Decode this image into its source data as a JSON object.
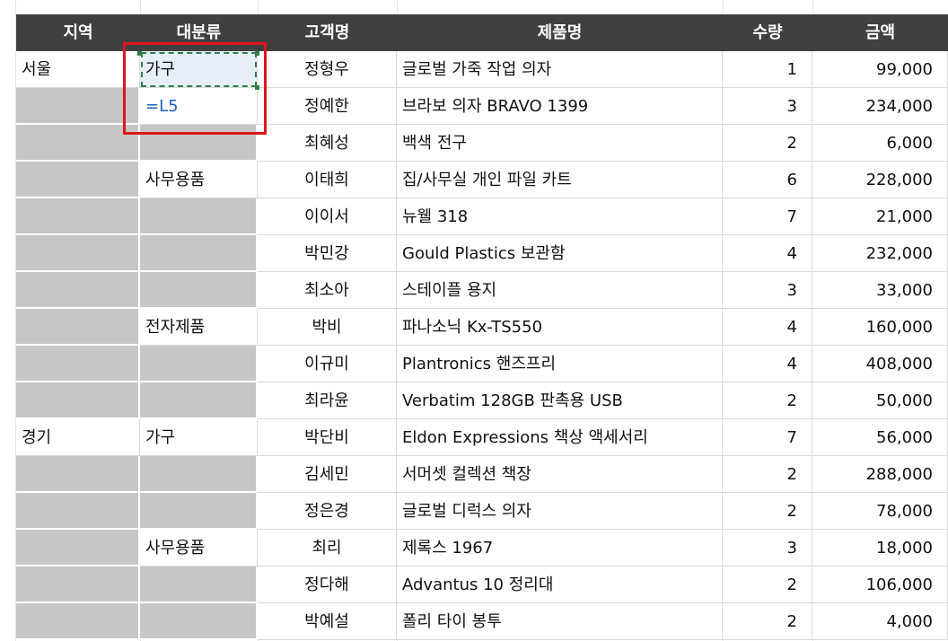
{
  "headers": [
    "지역",
    "대분류",
    "고객명",
    "제품명",
    "수량",
    "금액"
  ],
  "rows": [
    {
      "region": "서울",
      "category": "가구",
      "customer": "정형우",
      "product": "글로벌 가죽 작업 의자",
      "qty": "1",
      "amount": "99,000"
    },
    {
      "region": "",
      "category": "=L5",
      "customer": "정예한",
      "product": "브라보 의자 BRAVO 1399",
      "qty": "3",
      "amount": "234,000"
    },
    {
      "region": "",
      "category": "",
      "customer": "최혜성",
      "product": "백색 전구",
      "qty": "2",
      "amount": "6,000"
    },
    {
      "region": "",
      "category": "사무용품",
      "customer": "이태희",
      "product": "집/사무실 개인 파일 카트",
      "qty": "6",
      "amount": "228,000"
    },
    {
      "region": "",
      "category": "",
      "customer": "이이서",
      "product": "뉴웰 318",
      "qty": "7",
      "amount": "21,000"
    },
    {
      "region": "",
      "category": "",
      "customer": "박민강",
      "product": "Gould Plastics 보관함",
      "qty": "4",
      "amount": "232,000"
    },
    {
      "region": "",
      "category": "",
      "customer": "최소아",
      "product": "스테이플 용지",
      "qty": "3",
      "amount": "33,000"
    },
    {
      "region": "",
      "category": "전자제품",
      "customer": "박비",
      "product": "파나소닉 Kx-TS550",
      "qty": "4",
      "amount": "160,000"
    },
    {
      "region": "",
      "category": "",
      "customer": "이규미",
      "product": "Plantronics 핸즈프리",
      "qty": "4",
      "amount": "408,000"
    },
    {
      "region": "",
      "category": "",
      "customer": "최라윤",
      "product": "Verbatim 128GB 판촉용 USB",
      "qty": "2",
      "amount": "50,000"
    },
    {
      "region": "경기",
      "category": "가구",
      "customer": "박단비",
      "product": "Eldon Expressions 책상 액세서리",
      "qty": "7",
      "amount": "56,000"
    },
    {
      "region": "",
      "category": "",
      "customer": "김세민",
      "product": "서머셋 컬렉션 책장",
      "qty": "2",
      "amount": "288,000"
    },
    {
      "region": "",
      "category": "",
      "customer": "정은경",
      "product": "글로벌 디럭스 의자",
      "qty": "2",
      "amount": "78,000"
    },
    {
      "region": "",
      "category": "사무용품",
      "customer": "최리",
      "product": "제록스 1967",
      "qty": "3",
      "amount": "18,000"
    },
    {
      "region": "",
      "category": "",
      "customer": "정다해",
      "product": "Advantus 10 정리대",
      "qty": "2",
      "amount": "106,000"
    },
    {
      "region": "",
      "category": "",
      "customer": "박예설",
      "product": "폴리 타이 봉투",
      "qty": "2",
      "amount": "4,000"
    }
  ],
  "colors": {
    "header_bg": "#404040",
    "blank_cell": "#c6c6c6",
    "highlight_box": "#e0151b",
    "formula_text": "#1f5fbf",
    "selection_dash": "#2f7d4a"
  }
}
